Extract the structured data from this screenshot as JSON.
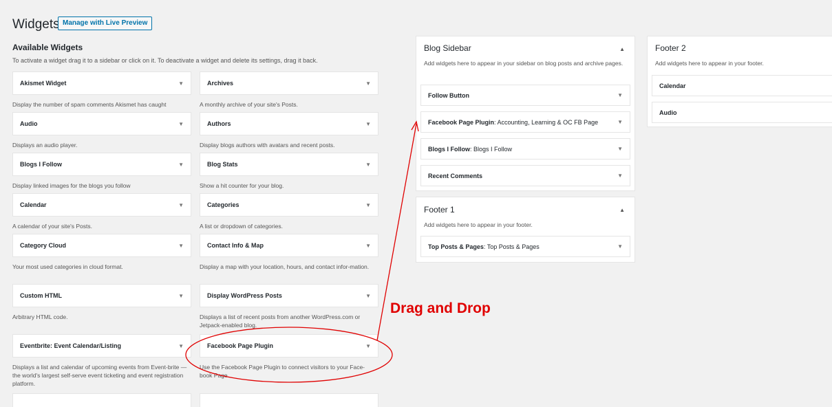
{
  "header": {
    "title": "Widgets",
    "live_preview_button": "Manage with Live Preview"
  },
  "available": {
    "title": "Available Widgets",
    "description": "To activate a widget drag it to a sidebar or click on it. To deactivate a widget and delete its settings, drag it back.",
    "widgets": [
      {
        "name": "Akismet Widget",
        "desc": "Display the number of spam comments Akismet has caught"
      },
      {
        "name": "Archives",
        "desc": "A monthly archive of your site's Posts."
      },
      {
        "name": "Audio",
        "desc": "Displays an audio player."
      },
      {
        "name": "Authors",
        "desc": "Display blogs authors with avatars and recent posts."
      },
      {
        "name": "Blogs I Follow",
        "desc": "Display linked images for the blogs you follow"
      },
      {
        "name": "Blog Stats",
        "desc": "Show a hit counter for your blog."
      },
      {
        "name": "Calendar",
        "desc": "A calendar of your site's Posts."
      },
      {
        "name": "Categories",
        "desc": "A list or dropdown of categories."
      },
      {
        "name": "Category Cloud",
        "desc": "Your most used categories in cloud format."
      },
      {
        "name": "Contact Info & Map",
        "desc": "Display a map with your location, hours, and contact infor-mation."
      },
      {
        "name": "Custom HTML",
        "desc": "Arbitrary HTML code."
      },
      {
        "name": "Display WordPress Posts",
        "desc": "Displays a list of recent posts from another WordPress.com or Jetpack-enabled blog."
      },
      {
        "name": "Eventbrite: Event Calendar/Listing",
        "desc": "Displays a list and calendar of upcoming events from Event-brite — the world's largest self-serve event ticketing and event registration platform."
      },
      {
        "name": "Facebook Page Plugin",
        "desc": "Use the Facebook Page Plugin to connect visitors to your Face-book Page"
      }
    ]
  },
  "blog_sidebar": {
    "title": "Blog Sidebar",
    "description": "Add widgets here to appear in your sidebar on blog posts and archive pages.",
    "widgets": [
      {
        "name": "Follow Button",
        "subtitle": ""
      },
      {
        "name": "Facebook Page Plugin",
        "subtitle": ": Accounting, Learning & OC FB Page"
      },
      {
        "name": "Blogs I Follow",
        "subtitle": ": Blogs I Follow"
      },
      {
        "name": "Recent Comments",
        "subtitle": ""
      }
    ]
  },
  "footer1": {
    "title": "Footer 1",
    "description": "Add widgets here to appear in your footer.",
    "widgets": [
      {
        "name": "Top Posts & Pages",
        "subtitle": ": Top Posts & Pages"
      }
    ]
  },
  "footer2": {
    "title": "Footer 2",
    "description": "Add widgets here to appear in your footer.",
    "widgets": [
      {
        "name": "Calendar",
        "subtitle": ""
      },
      {
        "name": "Audio",
        "subtitle": ""
      }
    ]
  },
  "annotation": {
    "text": "Drag and Drop",
    "color": "#e00000"
  },
  "icons": {
    "collapse": "arrow-down-icon",
    "expand": "arrow-up-icon"
  }
}
